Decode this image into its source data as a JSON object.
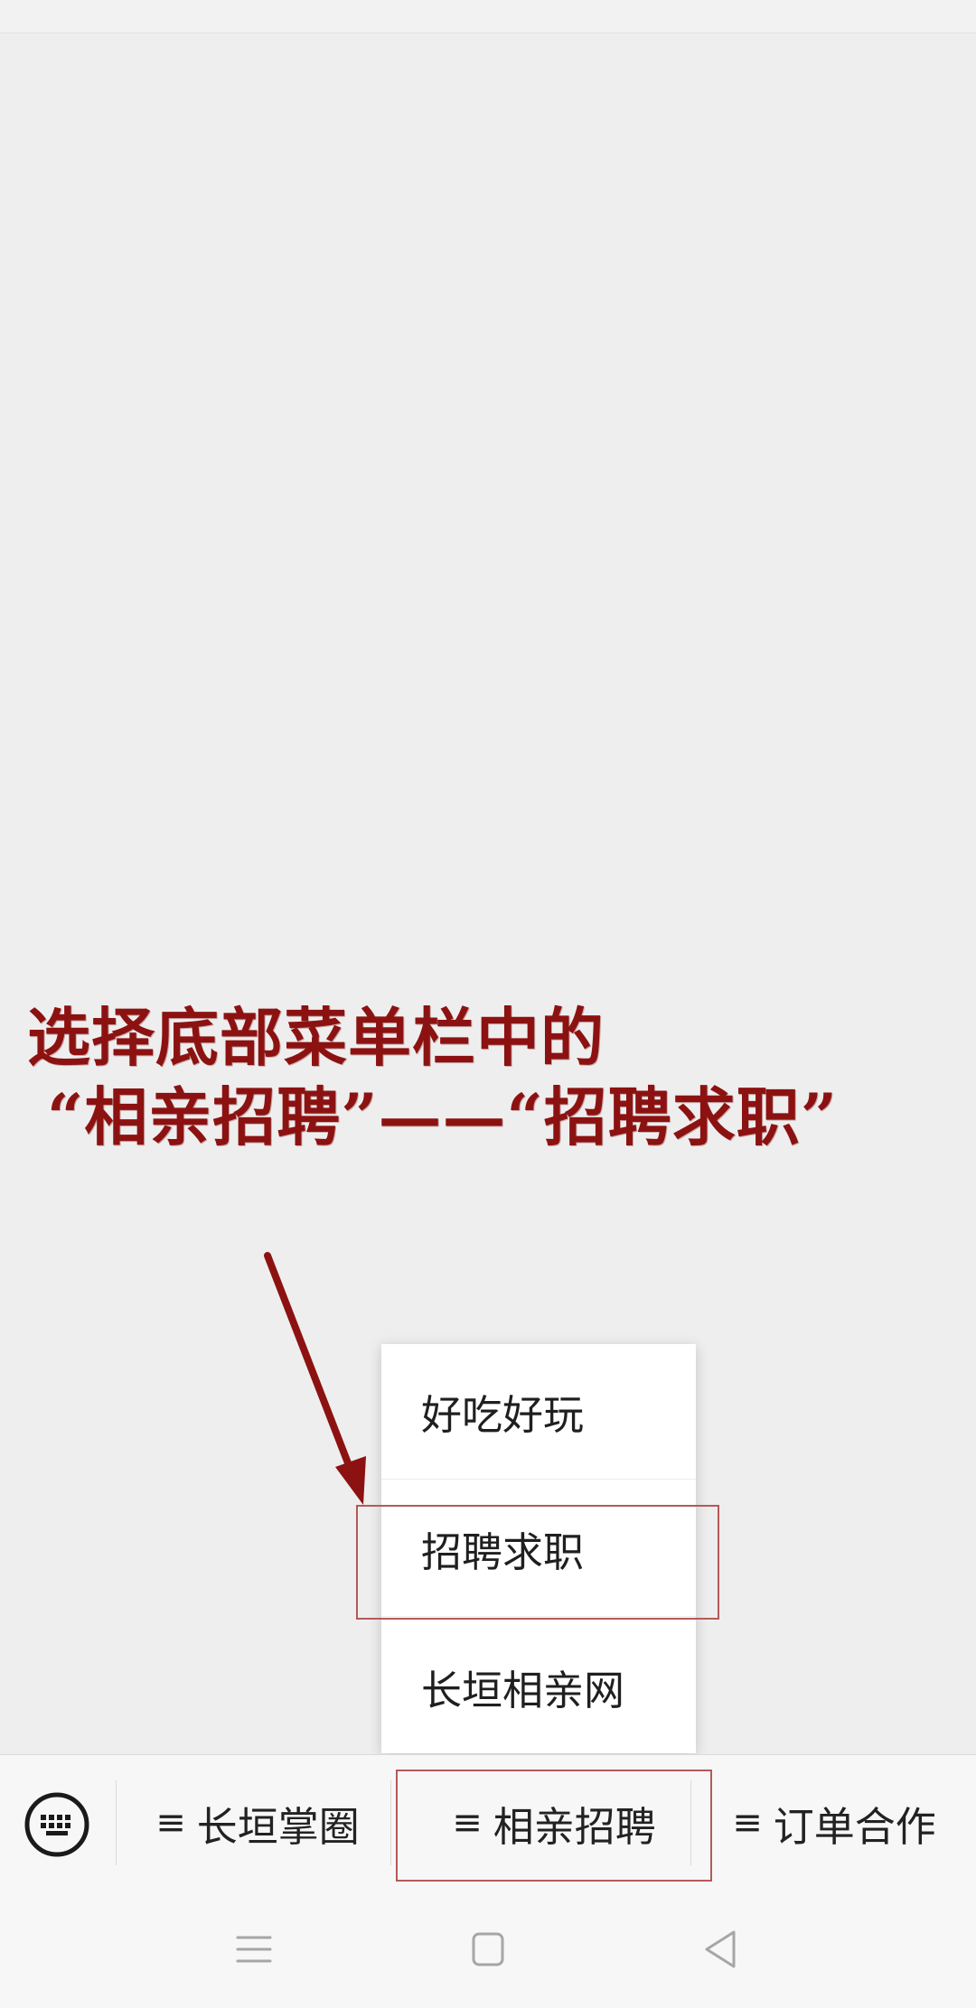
{
  "annotation": {
    "line1": "选择底部菜单栏中的",
    "line2": "“相亲招聘”——“招聘求职”",
    "color": "#8c1212"
  },
  "submenu": {
    "items": [
      {
        "label": "好吃好玩"
      },
      {
        "label": "招聘求职"
      },
      {
        "label": "长垣相亲网"
      }
    ]
  },
  "menu_bar": {
    "keyboard_icon": "keyboard-icon",
    "burger_glyph": "≡",
    "buttons": [
      {
        "label": "长垣掌圈"
      },
      {
        "label": "相亲招聘"
      },
      {
        "label": "订单合作"
      }
    ]
  },
  "nav_bar": {
    "icons": [
      "menu-icon",
      "home-square-icon",
      "back-triangle-icon"
    ]
  },
  "highlight_color": "#b45a5a"
}
